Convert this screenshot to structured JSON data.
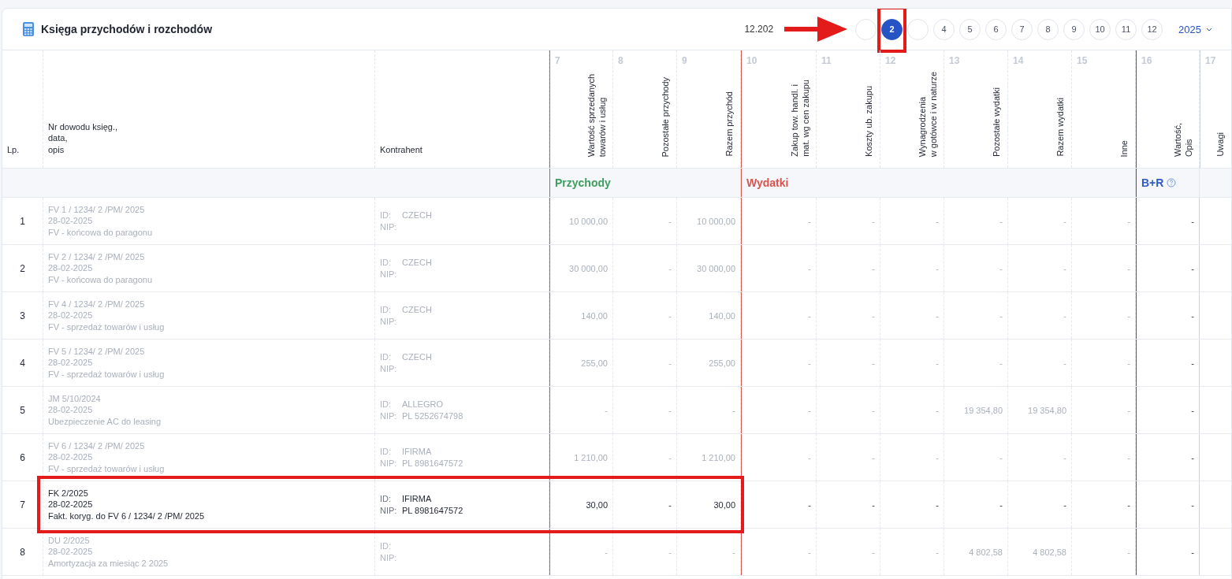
{
  "title": "Księga przychodów i rozchodów",
  "pager": {
    "period": "12.202",
    "arrow": true,
    "year": "2025",
    "months": [
      {
        "selected": false,
        "framed": false
      },
      {
        "label": "2",
        "selected": true,
        "framed": true
      },
      {
        "selected": false,
        "framed": false
      },
      {
        "label": "4",
        "selected": false,
        "framed": false
      },
      {
        "label": "5",
        "selected": false,
        "framed": false
      },
      {
        "label": "6",
        "selected": false,
        "framed": false
      },
      {
        "label": "7",
        "selected": false,
        "framed": false
      },
      {
        "label": "8",
        "selected": false,
        "framed": false
      },
      {
        "label": "9",
        "selected": false,
        "framed": false
      },
      {
        "label": "10",
        "selected": false,
        "framed": false
      },
      {
        "label": "11",
        "selected": false,
        "framed": false
      },
      {
        "label": "12",
        "selected": false,
        "framed": false
      }
    ]
  },
  "columns": [
    {
      "kind": "plain",
      "label": "Lp."
    },
    {
      "kind": "plain",
      "label": "Nr dowodu księg.,\ndata,\nopis"
    },
    {
      "kind": "plain",
      "label": "Kontrahent"
    },
    {
      "kind": "vertical",
      "number": "7",
      "label": "Wartość sprzedanych\ntowarów i usług"
    },
    {
      "kind": "vertical",
      "number": "8",
      "label": "Pozostałe przychody"
    },
    {
      "kind": "vertical",
      "number": "9",
      "label": "Razem przychód"
    },
    {
      "kind": "vertical",
      "number": "10",
      "label": "Zakup tow. handl. i\nmat. wg cen zakupu"
    },
    {
      "kind": "vertical",
      "number": "11",
      "label": "Koszty ub. zakupu"
    },
    {
      "kind": "vertical",
      "number": "12",
      "label": "Wynagrodzenia\nw gotówce i w naturze"
    },
    {
      "kind": "vertical",
      "number": "13",
      "label": "Pozostałe wydatki"
    },
    {
      "kind": "vertical",
      "number": "14",
      "label": "Razem wydatki"
    },
    {
      "kind": "vertical",
      "number": "15",
      "label": "Inne"
    },
    {
      "kind": "vertical",
      "number": "16",
      "label": "Wartość,\nOpis"
    },
    {
      "kind": "vertical",
      "number": "17",
      "label": "Uwagi"
    }
  ],
  "groups": [
    {
      "label": "Przychody",
      "color": "#3f9e5f",
      "help": false
    },
    {
      "label": "Wydatki",
      "color": "#d9534f",
      "help": false
    },
    {
      "label": "B+R",
      "color": "#2f5bc4",
      "help": true
    }
  ],
  "rows": [
    {
      "lp": "1",
      "doc": "FV 1 / 1234/ 2 /PM/ 2025",
      "date": "28-02-2025",
      "desc": "FV - końcowa do paragonu",
      "id_label": "ID:",
      "id": "CZECH",
      "nip_label": "NIP:",
      "values": [
        "10 000,00",
        "-",
        "10 000,00",
        "-",
        "-",
        "-",
        "-",
        "-",
        "-"
      ],
      "br": "-",
      "dimmed": true,
      "framed": false
    },
    {
      "lp": "2",
      "doc": "FV 2 / 1234/ 2 /PM/ 2025",
      "date": "28-02-2025",
      "desc": "FV - końcowa do paragonu",
      "id_label": "ID:",
      "id": "CZECH",
      "nip_label": "NIP:",
      "values": [
        "30 000,00",
        "-",
        "30 000,00",
        "-",
        "-",
        "-",
        "-",
        "-",
        "-"
      ],
      "br": "-",
      "dimmed": true,
      "framed": false
    },
    {
      "lp": "3",
      "doc": "FV 4 / 1234/ 2 /PM/ 2025",
      "date": "28-02-2025",
      "desc": "FV - sprzedaż towarów i usług",
      "id_label": "ID:",
      "id": "CZECH",
      "nip_label": "NIP:",
      "values": [
        "140,00",
        "-",
        "140,00",
        "-",
        "-",
        "-",
        "-",
        "-",
        "-"
      ],
      "br": "-",
      "dimmed": true,
      "framed": false
    },
    {
      "lp": "4",
      "doc": "FV 5 / 1234/ 2 /PM/ 2025",
      "date": "28-02-2025",
      "desc": "FV - sprzedaż towarów i usług",
      "id_label": "ID:",
      "id": "CZECH",
      "nip_label": "NIP:",
      "values": [
        "255,00",
        "-",
        "255,00",
        "-",
        "-",
        "-",
        "-",
        "-",
        "-"
      ],
      "br": "-",
      "dimmed": true,
      "framed": false
    },
    {
      "lp": "5",
      "doc": "JM 5/10/2024",
      "date": "28-02-2025",
      "desc": "Ubezpieczenie AC do leasing",
      "id_label": "ID:",
      "id": "ALLEGRO",
      "nip_label": "NIP:",
      "nip": "PL 5252674798",
      "values": [
        "-",
        "-",
        "-",
        "-",
        "-",
        "-",
        "19 354,80",
        "19 354,80",
        "-"
      ],
      "br": "-",
      "dimmed": true,
      "framed": false
    },
    {
      "lp": "6",
      "doc": "FV 6 / 1234/ 2 /PM/ 2025",
      "date": "28-02-2025",
      "desc": "FV - sprzedaż towarów i usług",
      "id_label": "ID:",
      "id": "IFIRMA",
      "nip_label": "NIP:",
      "nip": "PL 8981647572",
      "values": [
        "1 210,00",
        "-",
        "1 210,00",
        "-",
        "-",
        "-",
        "-",
        "-",
        "-"
      ],
      "br": "-",
      "dimmed": true,
      "framed": false
    },
    {
      "lp": "7",
      "doc": "FK 2/2025",
      "date": "28-02-2025",
      "desc": "Fakt. koryg. do FV 6 / 1234/ 2 /PM/ 2025",
      "id_label": "ID:",
      "id": "IFIRMA",
      "nip_label": "NIP:",
      "nip": "PL 8981647572",
      "values": [
        "30,00",
        "-",
        "30,00",
        "-",
        "-",
        "-",
        "-",
        "-",
        "-"
      ],
      "br": "-",
      "dimmed": false,
      "framed": true
    },
    {
      "lp": "8",
      "doc": "DU 2/2025",
      "date": "28-02-2025",
      "desc": "Amortyzacja za miesiąc 2 2025",
      "id_label": "ID:",
      "nip_label": "NIP:",
      "values": [
        "-",
        "-",
        "-",
        "-",
        "-",
        "-",
        "4 802,58",
        "4 802,58",
        "-"
      ],
      "br": "-",
      "dimmed": true,
      "framed": false
    }
  ]
}
